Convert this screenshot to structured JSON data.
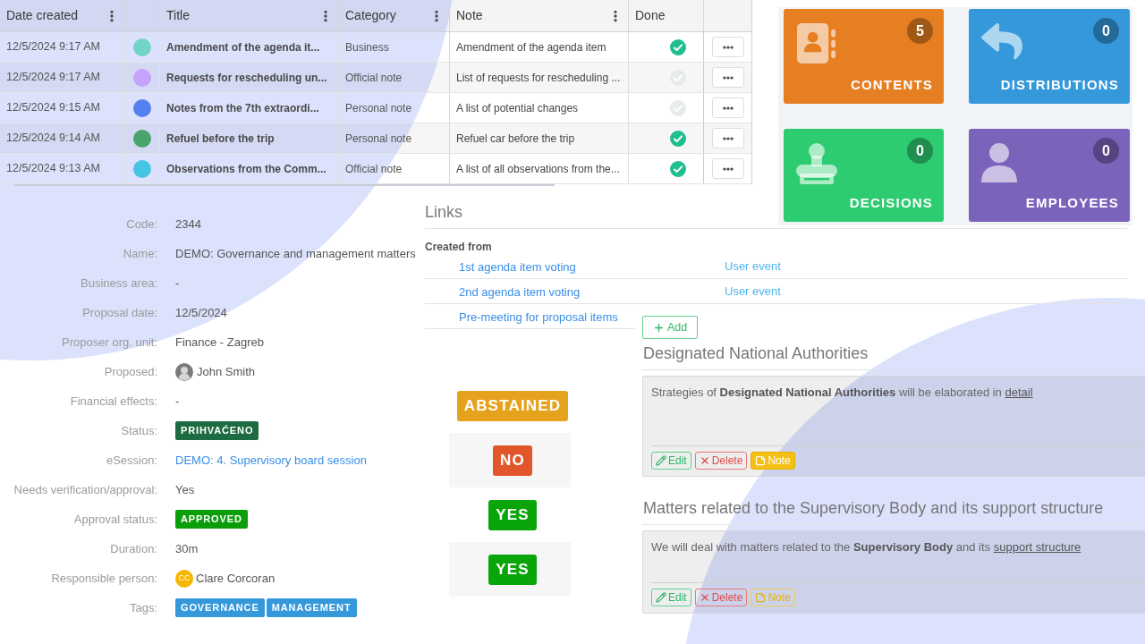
{
  "table": {
    "columns": [
      {
        "label": "Date created",
        "menu": true
      },
      {
        "label": "Title",
        "menu": true
      },
      {
        "label": "Category",
        "menu": true
      },
      {
        "label": "Note",
        "menu": true
      },
      {
        "label": "Done",
        "menu": false
      }
    ],
    "rows": [
      {
        "date": "12/5/2024 9:17 AM",
        "color": "#72d3c8",
        "title": "Amendment of the agenda it...",
        "category": "Business",
        "note": "Amendment of the agenda item",
        "done": true
      },
      {
        "date": "12/5/2024 9:17 AM",
        "color": "#c7a4fb",
        "title": "Requests for rescheduling un...",
        "category": "Official note",
        "note": "List of requests for rescheduling ...",
        "done": false
      },
      {
        "date": "12/5/2024 9:15 AM",
        "color": "#5580f0",
        "title": "Notes from the 7th extraordi...",
        "category": "Personal note",
        "note": "A list of potential changes",
        "done": false
      },
      {
        "date": "12/5/2024 9:14 AM",
        "color": "#48a46a",
        "title": "Refuel before the trip",
        "category": "Personal note",
        "note": "Refuel car before the trip",
        "done": true
      },
      {
        "date": "12/5/2024 9:13 AM",
        "color": "#45c4e4",
        "title": "Observations from the Comm...",
        "category": "Official note",
        "note": "A list of all observations from the...",
        "done": true
      }
    ]
  },
  "tiles": [
    {
      "kind": "contacts",
      "label": "CONTENTS",
      "count": "5",
      "color": "#e67e22"
    },
    {
      "kind": "reply",
      "label": "DISTRIBUTIONS",
      "count": "0",
      "color": "#3498db"
    },
    {
      "kind": "stamp",
      "label": "DECISIONS",
      "count": "0",
      "color": "#2ecc71"
    },
    {
      "kind": "user",
      "label": "EMPLOYEES",
      "count": "0",
      "color": "#7b62bb"
    }
  ],
  "details": {
    "fields": [
      {
        "kind": "text",
        "label": "Code:",
        "value": "2344"
      },
      {
        "kind": "text",
        "label": "Name:",
        "value": "DEMO: Governance and management matters"
      },
      {
        "kind": "text",
        "label": "Business area:",
        "value": "-"
      },
      {
        "kind": "text",
        "label": "Proposal date:",
        "value": "12/5/2024"
      },
      {
        "kind": "text",
        "label": "Proposer org. unit:",
        "value": "Finance - Zagreb"
      },
      {
        "kind": "person_photo",
        "label": "Proposed:",
        "value": "John Smith"
      },
      {
        "kind": "text",
        "label": "Financial effects:",
        "value": "-"
      },
      {
        "kind": "badge",
        "label": "Status:",
        "value": "PRIHVAĆENO",
        "color": "#1d6b40"
      },
      {
        "kind": "link",
        "label": "eSession:",
        "value": "DEMO: 4. Supervisory board session"
      },
      {
        "kind": "text",
        "label": "Needs verification/approval:",
        "value": "Yes"
      },
      {
        "kind": "badge",
        "label": "Approval status:",
        "value": "APPROVED",
        "color": "#0b9e0b"
      },
      {
        "kind": "text",
        "label": "Duration:",
        "value": "30m"
      },
      {
        "kind": "person_initials",
        "label": "Responsible person:",
        "initials": "CC",
        "value": "Clare Corcoran"
      },
      {
        "kind": "tags",
        "label": "Tags:",
        "tags": [
          "GOVERNANCE",
          "MANAGEMENT"
        ],
        "color": "#3498db"
      }
    ]
  },
  "links": {
    "title": "Links",
    "group": "Created from",
    "items": [
      {
        "title": "1st agenda item voting",
        "type": "User event"
      },
      {
        "title": "2nd agenda item voting",
        "type": "User event"
      },
      {
        "title": "Pre-meeting for proposal items"
      }
    ],
    "add_button": "Add"
  },
  "votes": [
    {
      "label": "ABSTAINED",
      "color": "#e5a21d"
    },
    {
      "label": "NO",
      "color": "#e2562b"
    },
    {
      "label": "YES",
      "color": "#0aa50a"
    },
    {
      "label": "YES",
      "color": "#0aa50a"
    }
  ],
  "sections": [
    {
      "title": "Designated National Authorities",
      "text": "Strategies of **Designated National Authorities** will be elaborated in",
      "link": "detail",
      "buttons": [
        {
          "kind": "edit",
          "label": "Edit",
          "active": false
        },
        {
          "kind": "delete",
          "label": "Delete",
          "active": false
        },
        {
          "kind": "note",
          "label": "Note",
          "active": true
        }
      ]
    },
    {
      "title": "Matters related to the Supervisory Body and its support structure",
      "text": "We will deal with matters related to the **Supervisory Body** and its",
      "link": "support structure",
      "buttons": [
        {
          "kind": "edit",
          "label": "Edit",
          "active": false
        },
        {
          "kind": "delete",
          "label": "Delete",
          "active": false
        },
        {
          "kind": "note",
          "label": "Note",
          "active": false
        }
      ]
    }
  ]
}
